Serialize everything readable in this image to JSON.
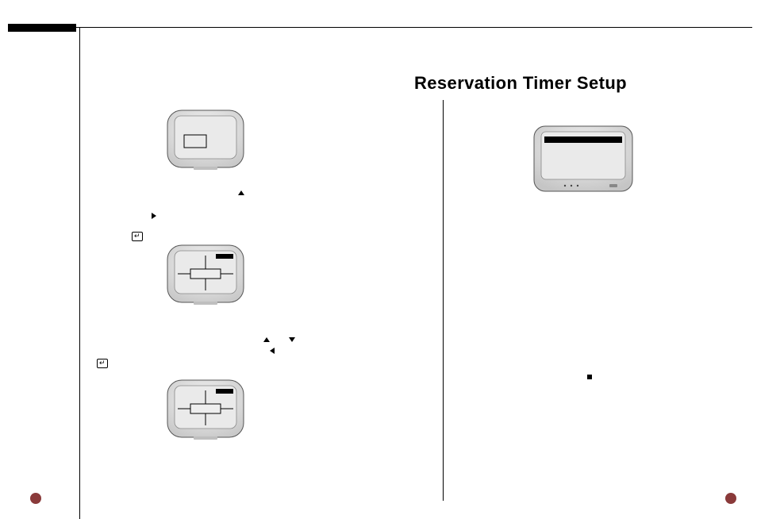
{
  "heading": "Reservation Timer Setup",
  "tv1": {
    "inner_box": true
  },
  "tv2": {
    "black_bar": true,
    "cross_box": true
  },
  "tv3": {
    "black_bar": true,
    "cross_box": true
  },
  "tv4": {
    "style": "wide",
    "black_bar": true
  },
  "annotations": {
    "group1_arrow_up": true,
    "group1_arrow_right": true,
    "group1_enter": true,
    "group2_arrow_up": true,
    "group2_arrow_down": true,
    "group2_arrow_left": true,
    "group2_enter": true,
    "small_square": true
  }
}
